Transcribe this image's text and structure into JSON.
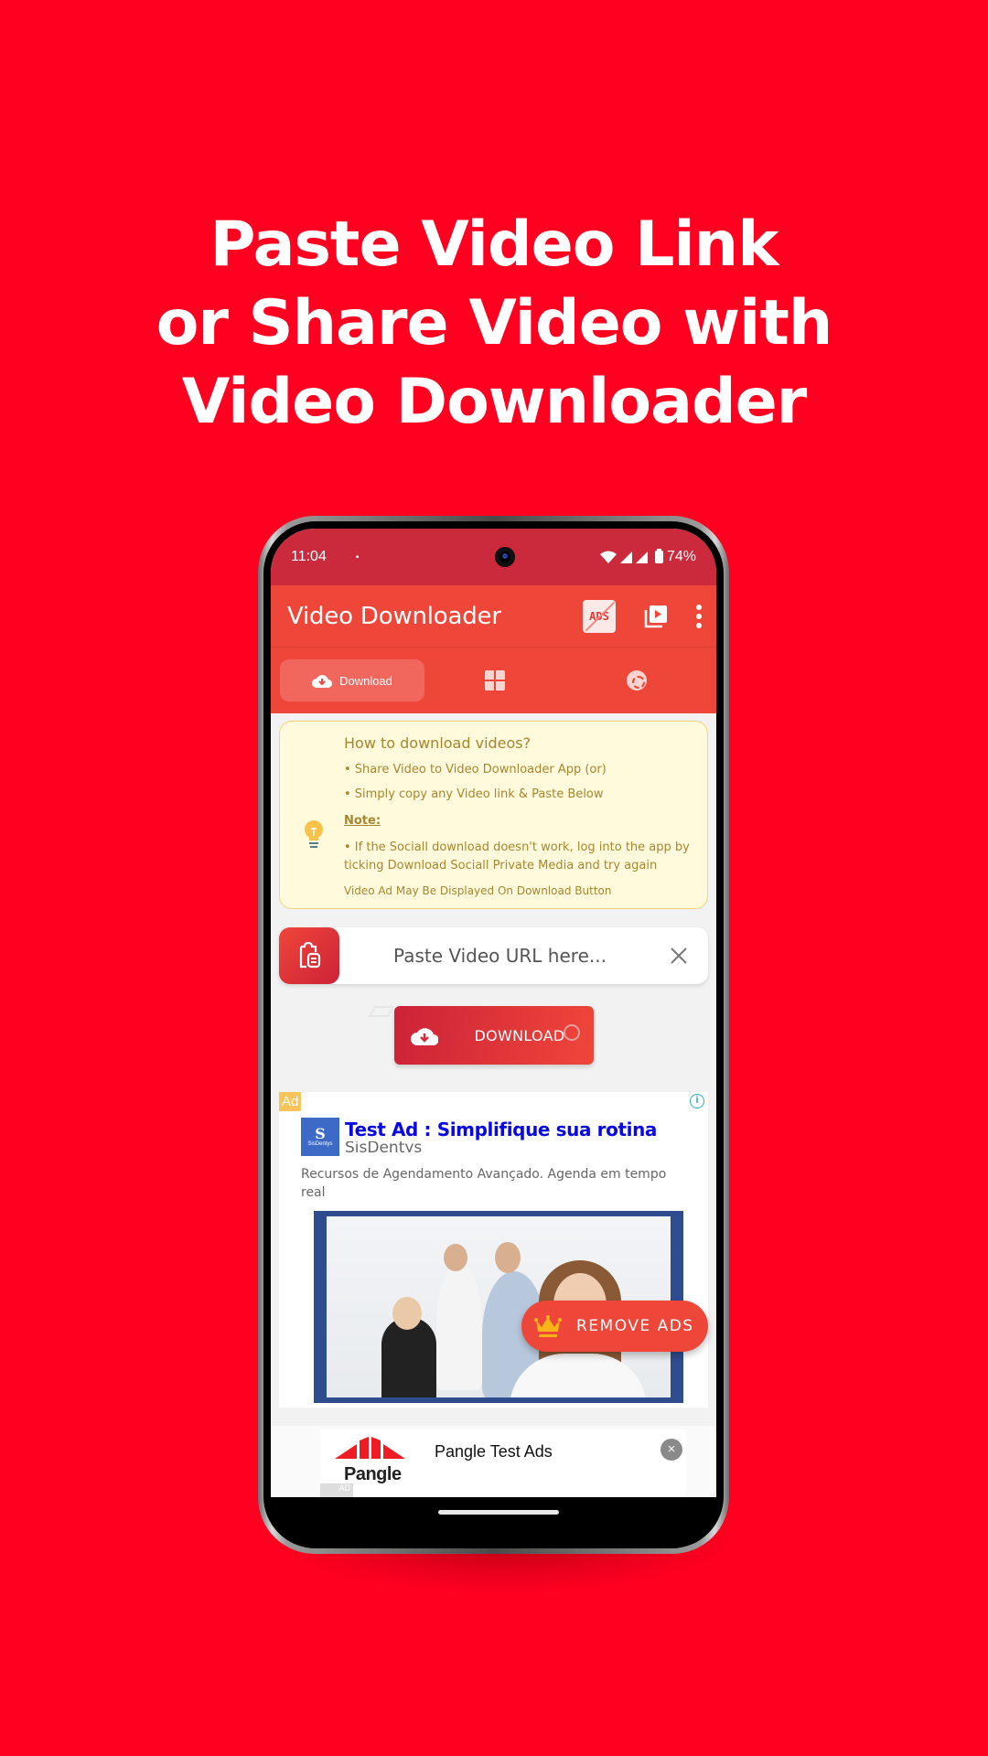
{
  "headline": {
    "lines": [
      "Paste Video Link",
      "or Share Video with",
      "Video Downloader"
    ]
  },
  "status_bar": {
    "time": "11:04",
    "battery": "74%"
  },
  "app_bar": {
    "title": "Video Downloader",
    "ads_icon_text": "ADS",
    "icons": [
      "remove-ads-icon",
      "video-library-icon",
      "more-vert-icon"
    ]
  },
  "tabs": [
    {
      "label": "Download",
      "icon": "cloud-download-icon",
      "active": true
    },
    {
      "label": "",
      "icon": "puzzle-icon",
      "active": false
    },
    {
      "label": "",
      "icon": "status-icon",
      "active": false
    }
  ],
  "info_card": {
    "heading": "How to download videos?",
    "bullets": [
      "• Share Video to Video Downloader App (or)",
      "• Simply copy any Video link & Paste Below"
    ],
    "note_label": "Note:",
    "note_text": "• If the Sociall download doesn't work, log into the app by ticking Download Sociall Private Media and try again",
    "footer": "Video Ad May Be Displayed On Download Button"
  },
  "url_input": {
    "placeholder": "Paste Video URL here...",
    "value": ""
  },
  "download_button": {
    "label": "DOWNLOAD"
  },
  "ad": {
    "badge": "Ad",
    "logo_letter": "S",
    "logo_name": "SisDentys",
    "title": "Test Ad : Simplifique sua rotina",
    "advertiser": "SisDentys",
    "description": "Recursos de Agendamento Avançado. Agenda em tempo real"
  },
  "remove_ads_button": {
    "label": "REMOVE ADS"
  },
  "bottom_ad": {
    "logo_text": "Pangle",
    "title": "Pangle Test Ads",
    "ad_tag": "AD"
  },
  "colors": {
    "background": "#ff0020",
    "status_bar": "#cb2a3d",
    "app_bar": "#ef463a",
    "info_card_bg": "#fffadc",
    "info_card_text": "#a8852e",
    "ad_title": "#0a0ae0",
    "ad_badge": "#fbc45a"
  }
}
